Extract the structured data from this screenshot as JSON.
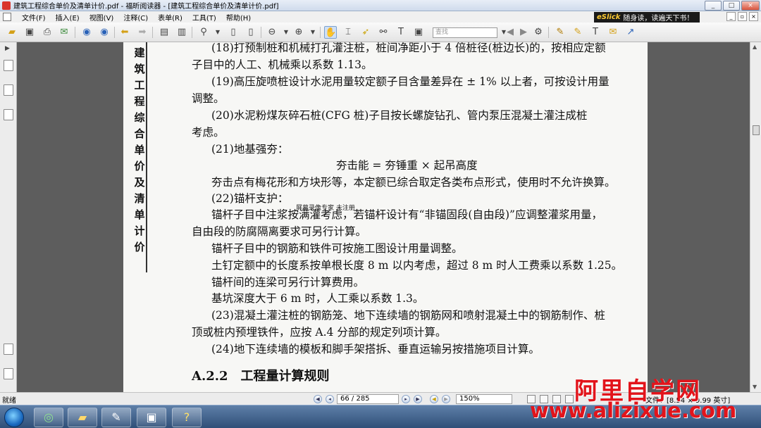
{
  "window": {
    "title": "建筑工程综合单价及清单计价.pdf - 福昕阅读器 - [建筑工程综合单价及清单计价.pdf]",
    "ad_brand": "eSlick",
    "ad_text": "随身读，读遍天下书！",
    "minimize": "_",
    "maximize": "□",
    "close": "×"
  },
  "menu": {
    "items": [
      "文件(F)",
      "插入(E)",
      "视图(V)",
      "注释(C)",
      "表单(R)",
      "工具(T)",
      "帮助(H)"
    ],
    "mdi_minimize": "_",
    "mdi_restore": "▫",
    "mdi_close": "×"
  },
  "toolbar": {
    "search_placeholder": "查找"
  },
  "document": {
    "sidebar_title": "建筑工程综合单价及清单计价",
    "lines": [
      "(18)打预制桩和机械打孔灌注桩，桩间净距小于 4 倍桩径(桩边长)的，按相应定额",
      "子目中的人工、机械乘以系数 1.13。",
      "(19)高压旋喷桩设计水泥用量较定额子目含量差异在 ± 1% 以上者，可按设计用量",
      "调整。",
      "(20)水泥粉煤灰碎石桩(CFG 桩)子目按长螺旋钻孔、管内泵压混凝土灌注成桩",
      "考虑。",
      "(21)地基强夯：",
      "夯击能 = 夯锤重 × 起吊高度",
      "夯击点有梅花形和方块形等，本定额已综合取定各类布点形式，使用时不允许换算。",
      "(22)锚杆支护：",
      "锚杆子目中注浆按满灌考虑，若锚杆设计有“非锚固段(自由段)”应调整灌浆用量，",
      "自由段的防腐隔离要求可另行计算。",
      "锚杆子目中的钢筋和铁件可按施工图设计用量调整。",
      "土钉定额中的长度系按单根长度 8 m 以内考虑，超过 8 m 时人工费乘以系数 1.25。",
      "锚杆间的连梁可另行计算费用。",
      "基坑深度大于 6 m 时，人工乘以系数 1.3。",
      "(23)混凝土灌注桩的钢筋笼、地下连续墙的钢筋网和喷射混凝土中的钢筋制作、桩",
      "顶或桩内预埋铁件，应按 A.4 分部的规定列项计算。",
      "(24)地下连续墙的模板和脚手架搭拆、垂直运输另按措施项目计算。"
    ],
    "section_heading": "A.2.2　工程量计算规则",
    "overlay_note": "屏幕录像专家 未注册"
  },
  "status": {
    "ready": "就绪",
    "page_indicator": "66 / 285",
    "zoom": "150%",
    "page_size": "文件：[8.54 × 9.99 英寸]"
  },
  "watermark": {
    "site_name": "阿里自学网",
    "site_url": "www.alizixue.com"
  },
  "colors": {
    "watermark_red": "#e2141b",
    "document_bg": "#5d5d5d"
  }
}
